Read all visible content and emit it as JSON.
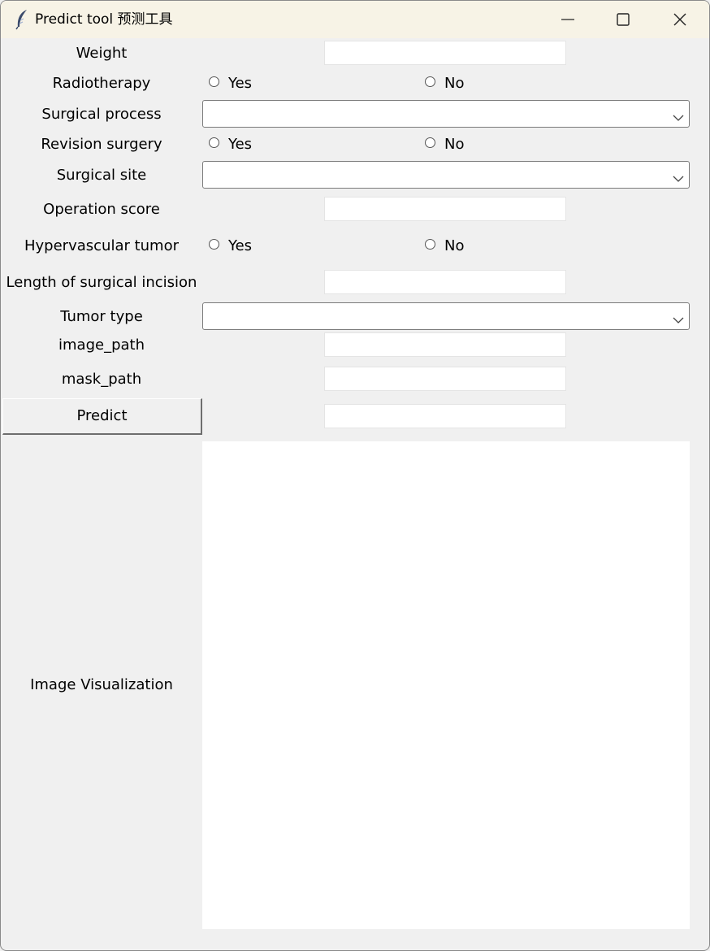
{
  "window": {
    "title": "Predict tool 预测工具",
    "icon": "feather-icon",
    "controls": [
      "minimize-icon",
      "maximize-icon",
      "close-icon"
    ]
  },
  "form": {
    "weight": {
      "label": "Weight",
      "value": ""
    },
    "radiotherapy": {
      "label": "Radiotherapy",
      "options": [
        "Yes",
        "No"
      ],
      "selected": null
    },
    "surgical_process": {
      "label": "Surgical process",
      "value": ""
    },
    "revision_surgery": {
      "label": "Revision surgery",
      "options": [
        "Yes",
        "No"
      ],
      "selected": null
    },
    "surgical_site": {
      "label": "Surgical site",
      "value": ""
    },
    "operation_score": {
      "label": "Operation score",
      "value": ""
    },
    "hypervascular_tumor": {
      "label": "Hypervascular tumor",
      "options": [
        "Yes",
        "No"
      ],
      "selected": null
    },
    "incision_length": {
      "label": "Length of surgical incision",
      "value": ""
    },
    "tumor_type": {
      "label": "Tumor type",
      "value": ""
    },
    "image_path": {
      "label": "image_path",
      "value": ""
    },
    "mask_path": {
      "label": "mask_path",
      "value": ""
    }
  },
  "predict": {
    "button_label": "Predict",
    "result": ""
  },
  "visualization": {
    "label": "Image Visualization"
  }
}
